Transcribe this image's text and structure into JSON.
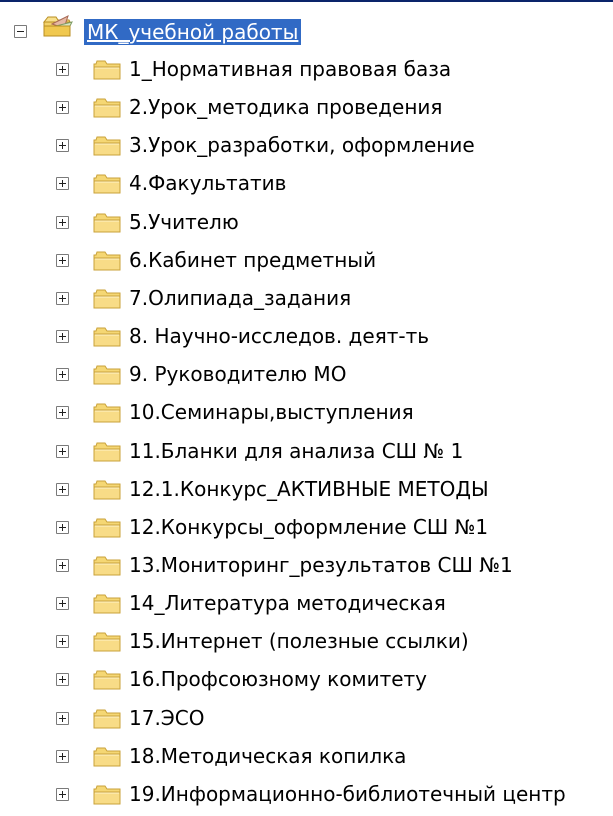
{
  "tree": {
    "root": {
      "label": "МК_учебной работы",
      "icon": "favorites-folder-icon",
      "expanded": true,
      "selected": true,
      "selection_color": "#316ac5"
    },
    "items": [
      {
        "label": "1_Нормативная  правовая  база",
        "icon": "folder-icon",
        "expanded": false
      },
      {
        "label": "2.Урок_методика проведения",
        "icon": "folder-icon",
        "expanded": false
      },
      {
        "label": "3.Урок_разработки, оформление",
        "icon": "folder-icon",
        "expanded": false
      },
      {
        "label": "4.Факультатив",
        "icon": "folder-icon",
        "expanded": false
      },
      {
        "label": "5.Учителю",
        "icon": "folder-icon",
        "expanded": false
      },
      {
        "label": "6.Кабинет предметный",
        "icon": "folder-icon",
        "expanded": false
      },
      {
        "label": "7.Олипиада_задания",
        "icon": "folder-icon",
        "expanded": false
      },
      {
        "label": "8. Научно-исследов. деят-ть",
        "icon": "folder-icon",
        "expanded": false
      },
      {
        "label": "9. Руководителю МО",
        "icon": "folder-icon",
        "expanded": false
      },
      {
        "label": "10.Семинары,выступления",
        "icon": "folder-icon",
        "expanded": false
      },
      {
        "label": "11.Бланки для анализа СШ № 1",
        "icon": "folder-icon",
        "expanded": false
      },
      {
        "label": "12.1.Конкурс_АКТИВНЫЕ МЕТОДЫ",
        "icon": "folder-icon",
        "expanded": false
      },
      {
        "label": "12.Конкурсы_оформление  СШ №1",
        "icon": "folder-icon",
        "expanded": false
      },
      {
        "label": "13.Мониторинг_результатов СШ №1",
        "icon": "folder-icon",
        "expanded": false
      },
      {
        "label": "14_Литература методическая",
        "icon": "folder-icon",
        "expanded": false
      },
      {
        "label": "15.Интернет (полезные ссылки)",
        "icon": "folder-icon",
        "expanded": false
      },
      {
        "label": "16.Профсоюзному комитету",
        "icon": "folder-icon",
        "expanded": false
      },
      {
        "label": "17.ЭСО",
        "icon": "folder-icon",
        "expanded": false
      },
      {
        "label": "18.Методическая копилка",
        "icon": "folder-icon",
        "expanded": false
      },
      {
        "label": "19.Информационно-библиотечный центр",
        "icon": "folder-icon",
        "expanded": false
      }
    ]
  },
  "colors": {
    "folder_fill": "#f5d774",
    "folder_outline": "#c9a23a",
    "selection": "#316ac5",
    "border": "#0a246a"
  }
}
